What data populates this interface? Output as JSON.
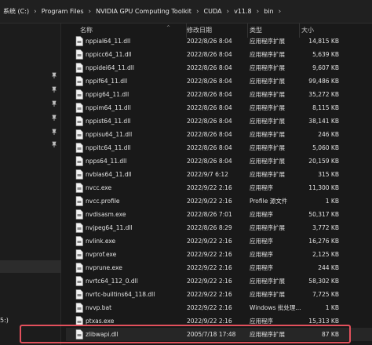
{
  "breadcrumb": {
    "items": [
      "系统 (C:)",
      "Program Files",
      "NVIDIA GPU Computing Toolkit",
      "CUDA",
      "v11.8",
      "bin"
    ],
    "separator": "›"
  },
  "columns": {
    "name": "名称",
    "date": "修改日期",
    "type": "类型",
    "size": "大小"
  },
  "nav": {
    "edge_label": "5:)"
  },
  "files": [
    {
      "name": "nppial64_11.dll",
      "date": "2022/8/26 8:04",
      "type": "应用程序扩展",
      "size": "14,815 KB"
    },
    {
      "name": "nppicc64_11.dll",
      "date": "2022/8/26 8:04",
      "type": "应用程序扩展",
      "size": "5,639 KB"
    },
    {
      "name": "nppidei64_11.dll",
      "date": "2022/8/26 8:04",
      "type": "应用程序扩展",
      "size": "9,607 KB"
    },
    {
      "name": "nppif64_11.dll",
      "date": "2022/8/26 8:04",
      "type": "应用程序扩展",
      "size": "99,486 KB"
    },
    {
      "name": "nppig64_11.dll",
      "date": "2022/8/26 8:04",
      "type": "应用程序扩展",
      "size": "35,272 KB"
    },
    {
      "name": "nppim64_11.dll",
      "date": "2022/8/26 8:04",
      "type": "应用程序扩展",
      "size": "8,115 KB"
    },
    {
      "name": "nppist64_11.dll",
      "date": "2022/8/26 8:04",
      "type": "应用程序扩展",
      "size": "38,141 KB"
    },
    {
      "name": "nppisu64_11.dll",
      "date": "2022/8/26 8:04",
      "type": "应用程序扩展",
      "size": "246 KB"
    },
    {
      "name": "nppitc64_11.dll",
      "date": "2022/8/26 8:04",
      "type": "应用程序扩展",
      "size": "5,060 KB"
    },
    {
      "name": "npps64_11.dll",
      "date": "2022/8/26 8:04",
      "type": "应用程序扩展",
      "size": "20,159 KB"
    },
    {
      "name": "nvblas64_11.dll",
      "date": "2022/9/7 6:12",
      "type": "应用程序扩展",
      "size": "315 KB"
    },
    {
      "name": "nvcc.exe",
      "date": "2022/9/22 2:16",
      "type": "应用程序",
      "size": "11,300 KB"
    },
    {
      "name": "nvcc.profile",
      "date": "2022/9/22 2:16",
      "type": "Profile 源文件",
      "size": "1 KB"
    },
    {
      "name": "nvdisasm.exe",
      "date": "2022/8/26 7:01",
      "type": "应用程序",
      "size": "50,317 KB"
    },
    {
      "name": "nvjpeg64_11.dll",
      "date": "2022/8/26 8:29",
      "type": "应用程序扩展",
      "size": "3,772 KB"
    },
    {
      "name": "nvlink.exe",
      "date": "2022/9/22 2:16",
      "type": "应用程序",
      "size": "16,276 KB"
    },
    {
      "name": "nvprof.exe",
      "date": "2022/9/22 2:16",
      "type": "应用程序",
      "size": "2,125 KB"
    },
    {
      "name": "nvprune.exe",
      "date": "2022/9/22 2:16",
      "type": "应用程序",
      "size": "244 KB"
    },
    {
      "name": "nvrtc64_112_0.dll",
      "date": "2022/9/22 2:16",
      "type": "应用程序扩展",
      "size": "58,302 KB"
    },
    {
      "name": "nvrtc-builtins64_118.dll",
      "date": "2022/9/22 2:16",
      "type": "应用程序扩展",
      "size": "7,725 KB"
    },
    {
      "name": "nvvp.bat",
      "date": "2022/9/22 2:16",
      "type": "Windows 批处理...",
      "size": "1 KB"
    },
    {
      "name": "ptxas.exe",
      "date": "2022/9/22 2:16",
      "type": "应用程序",
      "size": "15,313 KB"
    },
    {
      "name": "zlibwapi.dll",
      "date": "2005/7/18 17:48",
      "type": "应用程序扩展",
      "size": "87 KB"
    }
  ],
  "colors": {
    "background": "#191919",
    "highlight_border": "#e2505c",
    "text": "#e2e2e2"
  }
}
